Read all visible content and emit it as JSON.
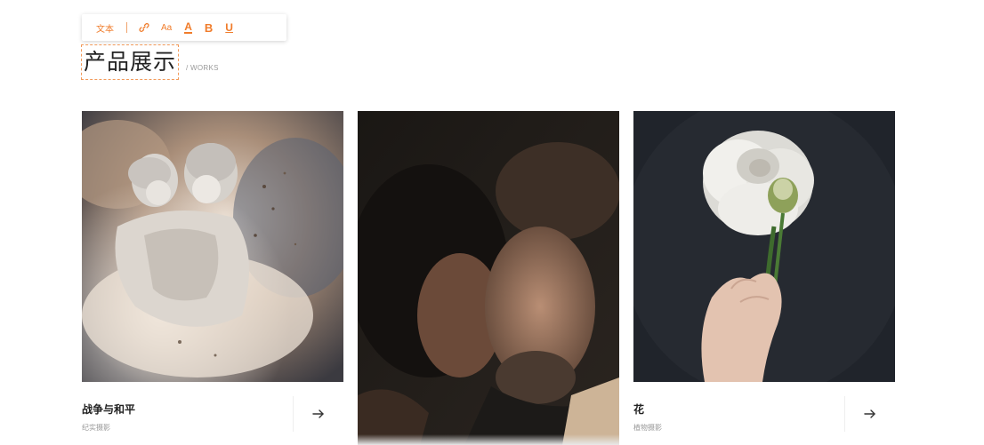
{
  "toolbar": {
    "text_label": "文本",
    "font_size_label": "Aa",
    "color_label": "A",
    "bold_label": "B",
    "underline_label": "U",
    "accent_color": "#f07c2b"
  },
  "section": {
    "title": "产品展示",
    "subtitle": "/ WORKS"
  },
  "cards": [
    {
      "title": "战争与和平",
      "subtitle": "纪实摄影",
      "image": "cherub-statues-dust-photo"
    },
    {
      "title": "",
      "subtitle": "",
      "image": "couple-embrace-dark-photo"
    },
    {
      "title": "花",
      "subtitle": "植物摄影",
      "image": "white-rose-in-hand-photo"
    }
  ]
}
